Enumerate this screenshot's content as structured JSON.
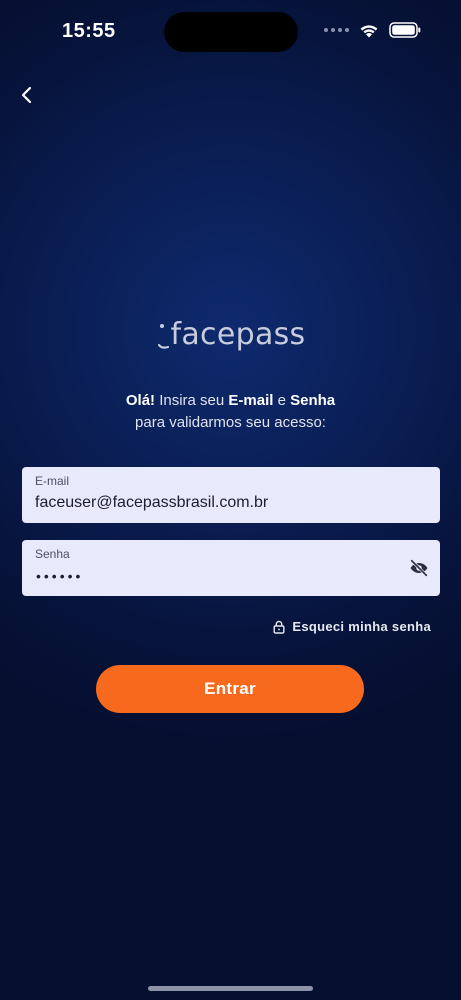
{
  "status_bar": {
    "time": "15:55"
  },
  "brand": {
    "logo_text": "facepass",
    "accent_color": "#f76a1e"
  },
  "greeting": {
    "hello": "Olá!",
    "part1": " Insira seu ",
    "email_word": "E-mail",
    "conj": " e ",
    "password_word": "Senha",
    "line2": "para validarmos seu acesso:"
  },
  "form": {
    "email": {
      "label": "E-mail",
      "value": "faceuser@facepassbrasil.com.br"
    },
    "password": {
      "label": "Senha",
      "masked_value": "••••••"
    },
    "forgot_label": "Esqueci minha senha",
    "submit_label": "Entrar"
  },
  "icons": {
    "back": "chevron-left-icon",
    "visibility": "eye-off-icon",
    "forgot": "lock-icon"
  }
}
